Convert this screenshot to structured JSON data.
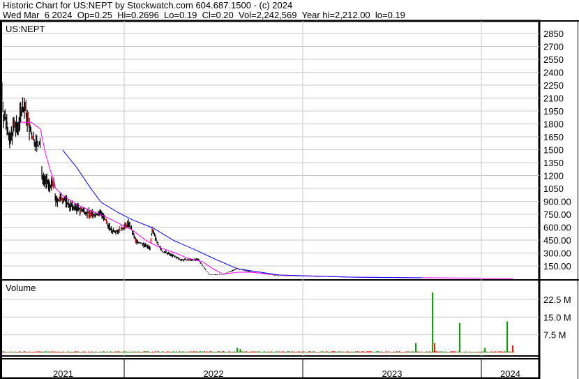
{
  "header": {
    "title": "Historic Chart for US:NEPT by Stockwatch.com 604.687.1500 - (c) 2024",
    "quote": "Wed Mar  6 2024  Op=0.25  Hi=0.2696  Lo=0.19  Cl=0.20  Vol=2,242,569  Year hi=2,212.00  lo=0.19"
  },
  "chart_data": {
    "type": "line",
    "symbol_label": "US:NEPT",
    "volume_label": "Volume",
    "x_unit": "year",
    "x_ticks": [
      "2021",
      "2022",
      "2023",
      "2024"
    ],
    "price_ylim": [
      0,
      2950
    ],
    "price_ticks": [
      "2850",
      "2700",
      "2550",
      "2400",
      "2250",
      "2100",
      "1950",
      "1800",
      "1650",
      "1500",
      "1350",
      "1200",
      "1050",
      "900.00",
      "750.00",
      "600.00",
      "450.00",
      "300.00",
      "150.00"
    ],
    "volume_ticks": [
      "22.5 M",
      "15.0 M",
      "7.5 M"
    ],
    "volume_ylim_millions": [
      0,
      29
    ],
    "colors": {
      "price": "#000000",
      "ma_short": "#ff00ff",
      "ma_long": "#0000ff",
      "vol_up": "#00a000",
      "vol_down": "#ff0000",
      "grid": "#c8c8c8"
    },
    "price": [
      [
        2021.316,
        2185
      ],
      [
        2021.324,
        1900
      ],
      [
        2021.344,
        1820
      ],
      [
        2021.359,
        1580
      ],
      [
        2021.383,
        1780
      ],
      [
        2021.402,
        1740
      ],
      [
        2021.422,
        1940
      ],
      [
        2021.441,
        2020
      ],
      [
        2021.453,
        1900
      ],
      [
        2021.469,
        1740
      ],
      [
        2021.492,
        1620
      ],
      [
        2021.52,
        1540
      ],
      [
        2021.531,
        1580
      ],
      [
        2021.539,
        1210
      ],
      [
        2021.578,
        1090
      ],
      [
        2021.609,
        1090
      ],
      [
        2021.617,
        890
      ],
      [
        2021.637,
        930
      ],
      [
        2021.664,
        930
      ],
      [
        2021.695,
        850
      ],
      [
        2021.734,
        820
      ],
      [
        2021.793,
        770
      ],
      [
        2021.832,
        740
      ],
      [
        2021.871,
        770
      ],
      [
        2021.891,
        690
      ],
      [
        2021.93,
        560
      ],
      [
        2021.969,
        560
      ],
      [
        2022.0,
        600
      ],
      [
        2022.027,
        645
      ],
      [
        2022.066,
        440
      ],
      [
        2022.105,
        400
      ],
      [
        2022.145,
        360
      ],
      [
        2022.156,
        560
      ],
      [
        2022.184,
        440
      ],
      [
        2022.211,
        320
      ],
      [
        2022.262,
        280
      ],
      [
        2022.32,
        220
      ],
      [
        2022.418,
        220
      ],
      [
        2022.438,
        160
      ],
      [
        2022.477,
        50
      ],
      [
        2022.555,
        50
      ],
      [
        2022.633,
        120
      ],
      [
        2022.711,
        80
      ],
      [
        2022.867,
        35
      ],
      [
        2023.258,
        20
      ],
      [
        2023.648,
        12
      ],
      [
        2024.176,
        5
      ]
    ],
    "ma_short": [
      [
        2021.422,
        1820
      ],
      [
        2021.48,
        1820
      ],
      [
        2021.531,
        1740
      ],
      [
        2021.559,
        1456
      ],
      [
        2021.617,
        1050
      ],
      [
        2021.656,
        970
      ],
      [
        2021.734,
        865
      ],
      [
        2021.813,
        792
      ],
      [
        2021.891,
        727
      ],
      [
        2021.969,
        646
      ],
      [
        2022.047,
        564
      ],
      [
        2022.125,
        442
      ],
      [
        2022.203,
        361
      ],
      [
        2022.281,
        304
      ],
      [
        2022.359,
        239
      ],
      [
        2022.438,
        199
      ],
      [
        2022.496,
        118
      ],
      [
        2022.555,
        53
      ],
      [
        2022.633,
        77
      ],
      [
        2022.711,
        77
      ],
      [
        2022.867,
        45
      ],
      [
        2023.258,
        20
      ],
      [
        2024.176,
        5
      ]
    ],
    "ma_long": [
      [
        2021.656,
        1496
      ],
      [
        2021.734,
        1294
      ],
      [
        2021.813,
        1051
      ],
      [
        2021.871,
        889
      ],
      [
        2021.969,
        767
      ],
      [
        2022.047,
        686
      ],
      [
        2022.164,
        588
      ],
      [
        2022.281,
        442
      ],
      [
        2022.398,
        337
      ],
      [
        2022.516,
        223
      ],
      [
        2022.633,
        118
      ],
      [
        2022.867,
        45
      ],
      [
        2023.258,
        20
      ],
      [
        2023.668,
        12
      ]
    ],
    "volume_spikes_millions": [
      [
        2022.633,
        2.0,
        "up"
      ],
      [
        2022.65,
        1.5,
        "up"
      ],
      [
        2023.633,
        4.0,
        "up"
      ],
      [
        2023.727,
        25.5,
        "up"
      ],
      [
        2023.738,
        4.0,
        "down"
      ],
      [
        2023.879,
        12.5,
        "up"
      ],
      [
        2024.02,
        2.0,
        "up"
      ],
      [
        2024.145,
        13.2,
        "up"
      ],
      [
        2024.176,
        3.0,
        "down"
      ]
    ]
  }
}
